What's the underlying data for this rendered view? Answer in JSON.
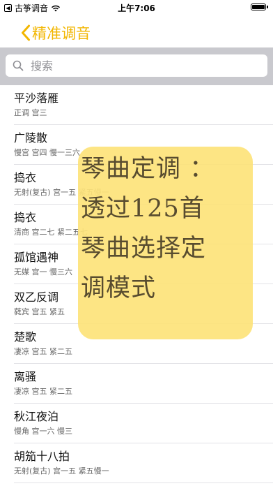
{
  "status_bar": {
    "carrier": "古筝调音",
    "time": "上午7:06"
  },
  "nav": {
    "title": "精准调音"
  },
  "search": {
    "placeholder": "搜索"
  },
  "songs": [
    {
      "title": "平沙落雁",
      "detail": "正调 宫三"
    },
    {
      "title": "广陵散",
      "detail": "慢宫 宫四 慢一三六"
    },
    {
      "title": "捣衣",
      "detail": "无射(复古) 宫一五 紧五慢一"
    },
    {
      "title": "捣衣",
      "detail": "清商 宫二七 紧二五七"
    },
    {
      "title": "孤馆遇神",
      "detail": "无媒 宫一 慢三六"
    },
    {
      "title": "双乙反调",
      "detail": "蕤宾 宫五 紧五"
    },
    {
      "title": "楚歌",
      "detail": "凄凉 宫五 紧二五"
    },
    {
      "title": "离骚",
      "detail": "凄凉 宫五 紧二五"
    },
    {
      "title": "秋江夜泊",
      "detail": "慢角 宫一六 慢三"
    },
    {
      "title": "胡笳十八拍",
      "detail": "无射(复古) 宫一五 紧五慢一"
    }
  ],
  "promo": {
    "lines": [
      "琴曲定调 ：",
      "透过125首",
      "琴曲选择定",
      "调模式"
    ],
    "background": "#fde37a"
  },
  "colors": {
    "accent": "#f2b600"
  }
}
